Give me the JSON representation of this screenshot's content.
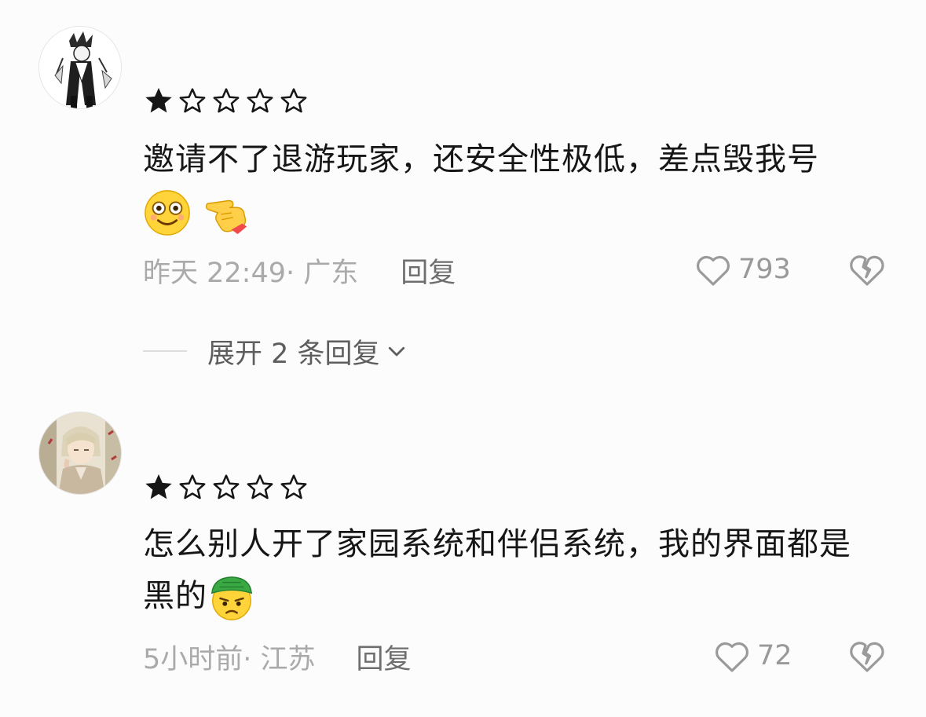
{
  "comments": [
    {
      "rating": 1,
      "rating_max": 5,
      "text": "邀请不了退游玩家，还安全性极低，差点毁我号",
      "emojis": [
        "smiling-face-icon",
        "pointing-hand-icon"
      ],
      "time": "昨天 22:49",
      "location": "· 广东",
      "reply_label": "回复",
      "likes": "793",
      "expand_label": "展开 2 条回复"
    },
    {
      "rating": 1,
      "rating_max": 5,
      "text": "怎么别人开了家园系统和伴侣系统，我的界面都是黑的",
      "emojis": [
        "green-hat-angry-face-icon"
      ],
      "time": "5小时前",
      "location": " · 江苏",
      "reply_label": "回复",
      "likes": "72"
    }
  ],
  "colors": {
    "text": "#161616",
    "meta": "#aaaaaa",
    "reply": "#6e6e6e",
    "icon": "#9a9a9a",
    "background": "#fcfcfc"
  }
}
